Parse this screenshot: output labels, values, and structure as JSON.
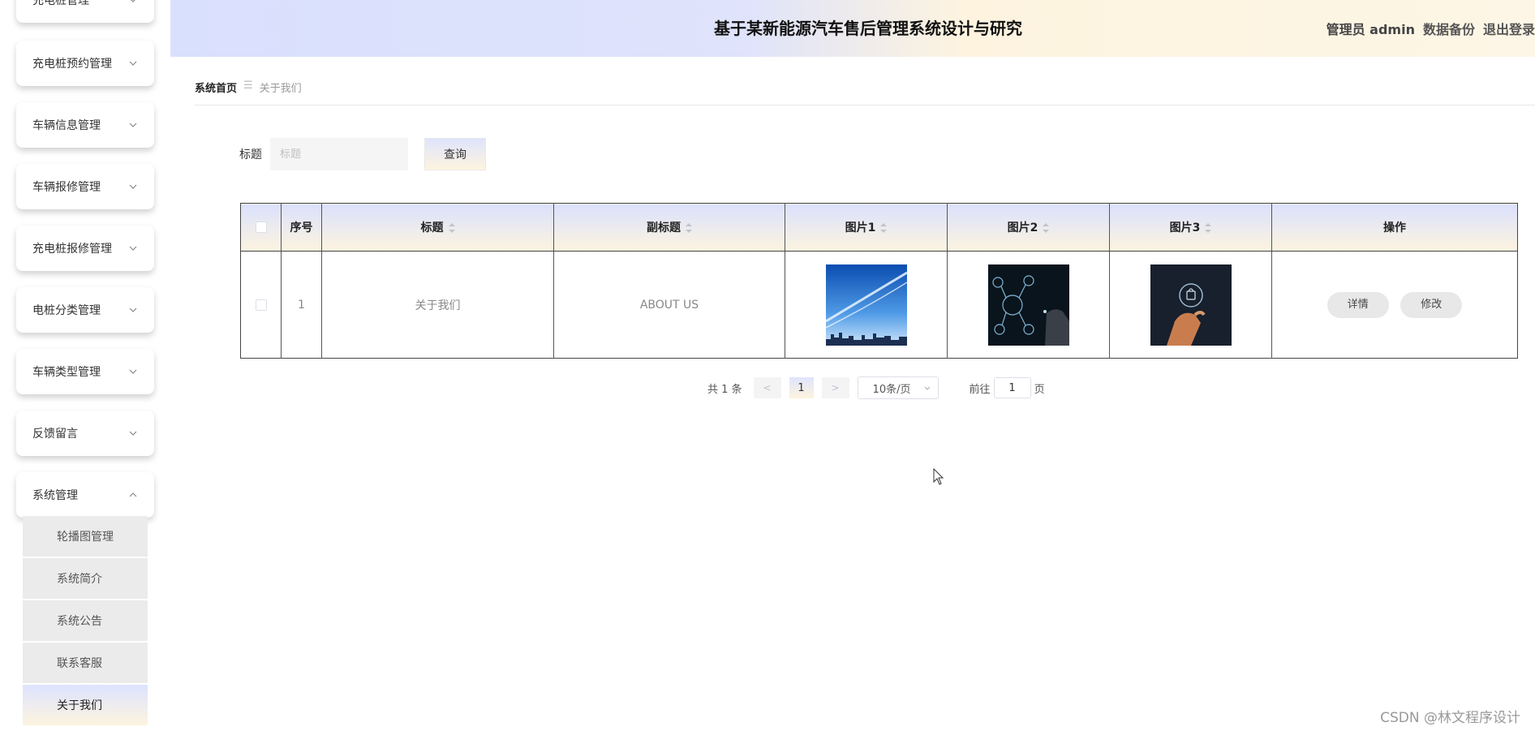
{
  "sidebar": {
    "items": [
      {
        "label": "充电桩管理"
      },
      {
        "label": "充电桩预约管理"
      },
      {
        "label": "车辆信息管理"
      },
      {
        "label": "车辆报修管理"
      },
      {
        "label": "充电桩报修管理"
      },
      {
        "label": "电桩分类管理"
      },
      {
        "label": "车辆类型管理"
      },
      {
        "label": "反馈留言"
      },
      {
        "label": "系统管理"
      }
    ],
    "submenu": [
      {
        "label": "轮播图管理"
      },
      {
        "label": "系统简介"
      },
      {
        "label": "系统公告"
      },
      {
        "label": "联系客服"
      },
      {
        "label": "关于我们"
      }
    ]
  },
  "header": {
    "title": "基于某新能源汽车售后管理系统设计与研究",
    "user": "管理员 admin",
    "backup": "数据备份",
    "logout": "退出登录"
  },
  "breadcrumb": {
    "home": "系统首页",
    "separator": "☰",
    "current": "关于我们"
  },
  "search": {
    "label": "标题",
    "placeholder": "标题",
    "button": "查询"
  },
  "table": {
    "headers": {
      "index": "序号",
      "title": "标题",
      "subtitle": "副标题",
      "img1": "图片1",
      "img2": "图片2",
      "img3": "图片3",
      "actions": "操作"
    },
    "rows": [
      {
        "index": "1",
        "title": "关于我们",
        "subtitle": "ABOUT US",
        "detail": "详情",
        "edit": "修改"
      }
    ]
  },
  "pagination": {
    "total": "共 1 条",
    "prev": "<",
    "current_page": "1",
    "next": ">",
    "page_size": "10条/页",
    "goto_prefix": "前往",
    "goto_value": "1",
    "goto_suffix": "页"
  },
  "watermark": "CSDN @林文程序设计",
  "colors": {
    "header_gradient_start": "#d9e0fd",
    "header_gradient_end": "#fdf6e6",
    "active_gradient_start": "#dde3ff",
    "active_gradient_end": "#fdf4df"
  }
}
